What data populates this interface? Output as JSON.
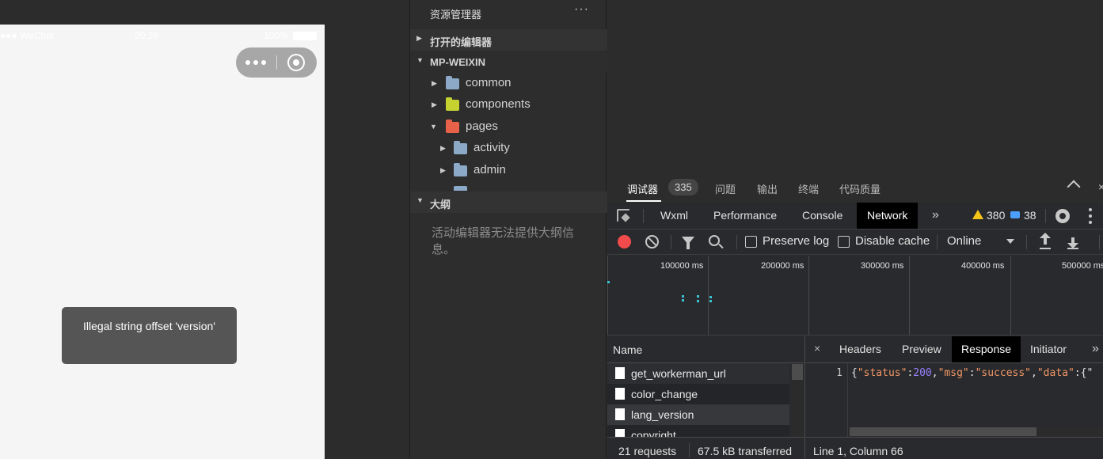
{
  "simulator": {
    "statusbar": {
      "carrier": "●●● WeChat",
      "time": "20:26",
      "battery": "100%"
    },
    "toast": "Illegal string offset 'version'"
  },
  "explorer": {
    "title": "资源管理器",
    "more": "···",
    "sections": {
      "open_editors": "打开的编辑器",
      "project": "MP-WEIXIN",
      "outline": "大纲"
    },
    "tree": [
      {
        "label": "common",
        "icon": "folder-icon",
        "color": "#8ca9c7"
      },
      {
        "label": "components",
        "icon": "components-folder-icon",
        "color": "#c5d230"
      },
      {
        "label": "pages",
        "icon": "pages-folder-icon",
        "color": "#e8624a"
      },
      {
        "label": "activity",
        "icon": "folder-icon",
        "color": "#8ca9c7"
      },
      {
        "label": "admin",
        "icon": "folder-icon",
        "color": "#8ca9c7"
      }
    ],
    "outline_message": "活动编辑器无法提供大纲信息。"
  },
  "devtools": {
    "top_tabs": [
      "调试器",
      "问题",
      "输出",
      "终端",
      "代码质量"
    ],
    "debugger_badge": "335",
    "close": "×",
    "panel_tabs": [
      "Wxml",
      "Performance",
      "Console",
      "Network"
    ],
    "more_tabs": "»",
    "warnings": "380",
    "messages": "38",
    "toolbar": {
      "preserve_log": "Preserve log",
      "disable_cache": "Disable cache",
      "throttling": "Online"
    },
    "timeline_labels": [
      "100000 ms",
      "200000 ms",
      "300000 ms",
      "400000 ms",
      "500000 ms"
    ],
    "name_header": "Name",
    "requests": [
      "get_workerman_url",
      "color_change",
      "lang_version",
      "copyright"
    ],
    "footer": {
      "requests": "21 requests",
      "transferred": "67.5 kB transferred"
    },
    "response_tabs": [
      "Headers",
      "Preview",
      "Response",
      "Initiator"
    ],
    "response_close": "×",
    "response": {
      "line_number": "1",
      "k_status": "\"status\"",
      "v_status": "200",
      "k_msg": "\"msg\"",
      "v_msg": "\"success\"",
      "k_data": "\"data\"",
      "tail": "{\""
    },
    "status_line": "Line 1, Column 66"
  },
  "colors": {
    "accent_record": "#f34b4b",
    "warning": "#f5c518",
    "message": "#4c9eff"
  }
}
